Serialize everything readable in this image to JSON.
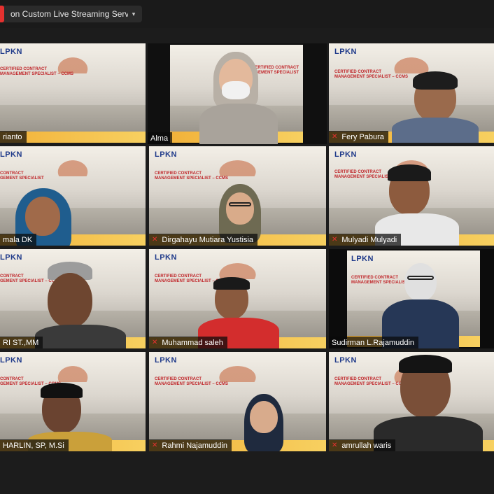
{
  "toolbar": {
    "live_label": "on Custom Live Streaming Service",
    "caret": "▾"
  },
  "mic_muted_glyph": "✕",
  "background_text": {
    "logo": "LPKN",
    "course": [
      "CERTIFIED CONTRACT",
      "MANAGEMENT SPECIALIST – CCMS"
    ]
  },
  "colors": {
    "active_speaker": "#d4e157",
    "muted_mic": "#e5312f",
    "banner": "#f2b23a"
  },
  "participants": [
    {
      "name": "rianto",
      "muted": false
    },
    {
      "name": "Alma",
      "muted": false,
      "active": true
    },
    {
      "name": "Fery Pabura",
      "muted": true
    },
    {
      "name": "mala DK",
      "muted": false
    },
    {
      "name": "Dirgahayu Mutiara Yustisia",
      "muted": true
    },
    {
      "name": "Mulyadi Mulyadi",
      "muted": true
    },
    {
      "name": "RI ST.,MM",
      "muted": false
    },
    {
      "name": "Muhammad saleh",
      "muted": true
    },
    {
      "name": "Sudirman L.Rajamuddin",
      "muted": false
    },
    {
      "name": "HARLIN, SP, M.Si",
      "muted": false
    },
    {
      "name": "Rahmi Najamuddin",
      "muted": true
    },
    {
      "name": "amrullah waris",
      "muted": true
    }
  ]
}
